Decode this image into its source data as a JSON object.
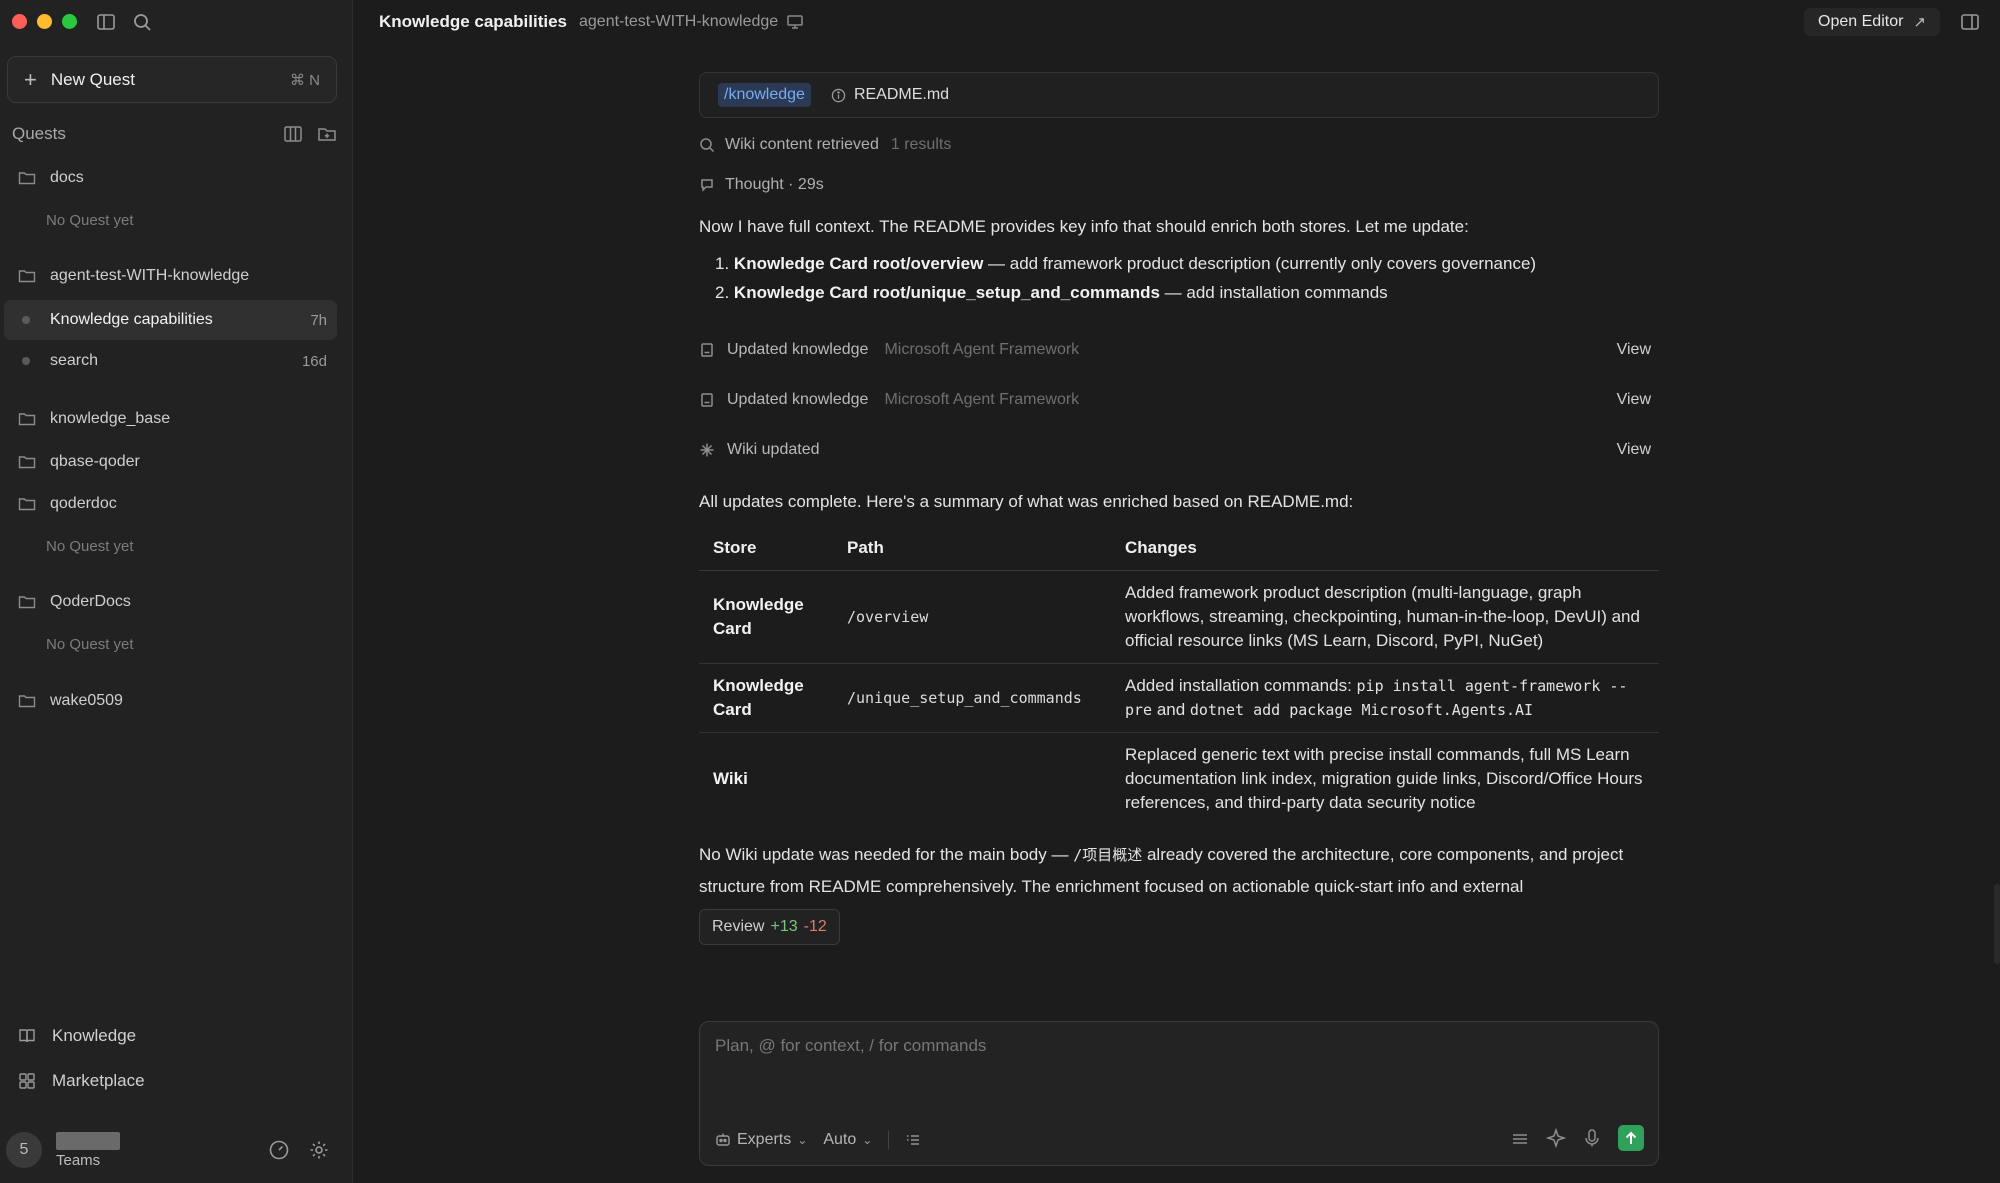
{
  "window": {
    "traffic_colors": [
      "#ff5f57",
      "#febc2e",
      "#28c840"
    ]
  },
  "sidebar": {
    "new_quest_label": "New Quest",
    "new_quest_shortcut": "⌘ N",
    "quests_title": "Quests",
    "groups": [
      {
        "name": "docs",
        "empty": "No Quest yet"
      },
      {
        "name": "agent-test-WITH-knowledge"
      },
      {
        "name": "knowledge_base"
      },
      {
        "name": "qbase-qoder"
      },
      {
        "name": "qoderdoc",
        "empty": "No Quest yet"
      },
      {
        "name": "QoderDocs",
        "empty": "No Quest yet"
      },
      {
        "name": "wake0509"
      }
    ],
    "quests": [
      {
        "name": "Knowledge capabilities",
        "age": "7h"
      },
      {
        "name": "search",
        "age": "16d"
      }
    ],
    "bottom": {
      "knowledge": "Knowledge",
      "marketplace": "Marketplace",
      "avatar_initial": "5",
      "team_label": "Teams"
    }
  },
  "topbar": {
    "title": "Knowledge capabilities",
    "subtitle": "agent-test-WITH-knowledge",
    "open_editor": "Open Editor"
  },
  "content": {
    "tag_path": "/knowledge",
    "tag_file": "README.md",
    "wiki_retrieved": "Wiki content retrieved",
    "wiki_results": "1 results",
    "thought": "Thought · 29s",
    "intro": "Now I have full context. The README provides key info that should enrich both stores. Let me update:",
    "list": [
      {
        "num": "1.",
        "bold": "Knowledge Card root/overview",
        "rest": " — add framework product description (currently only covers governance)"
      },
      {
        "num": "2.",
        "bold": "Knowledge Card root/unique_setup_and_commands",
        "rest": " — add installation commands"
      }
    ],
    "updates": [
      {
        "label": "Updated knowledge",
        "target": "Microsoft Agent Framework",
        "action": "View"
      },
      {
        "label": "Updated knowledge",
        "target": "Microsoft Agent Framework",
        "action": "View"
      },
      {
        "label": "Wiki updated",
        "target": "",
        "action": "View"
      }
    ],
    "summary_intro": "All updates complete. Here's a summary of what was enriched based on README.md:",
    "table": {
      "headers": [
        "Store",
        "Path",
        "Changes"
      ],
      "rows": [
        {
          "store": "Knowledge Card",
          "path": "/overview",
          "changes": "Added framework product description (multi-language, graph workflows, streaming, checkpointing, human-in-the-loop, DevUI) and official resource links (MS Learn, Discord, PyPI, NuGet)"
        },
        {
          "store": "Knowledge Card",
          "path": "/unique_setup_and_commands",
          "changes_a": "Added installation commands: ",
          "cmd1": "pip install agent-framework --pre",
          "changes_b": " and ",
          "cmd2": "dotnet add package Microsoft.Agents.AI"
        },
        {
          "store": "Wiki",
          "path": "",
          "changes": "Replaced generic text with precise install commands, full MS Learn documentation link index, migration guide links, Discord/Office Hours references, and third-party data security notice"
        }
      ]
    },
    "closing_a": "No Wiki update was needed for the main body — ",
    "closing_path": "/项目概述",
    "closing_b": " already covered the architecture, core components, and project structure from README comprehensively. The enrichment focused on actionable quick-start info and external",
    "review_label": "Review",
    "review_plus": "+13",
    "review_minus": "-12"
  },
  "composer": {
    "placeholder": "Plan, @ for context, / for commands",
    "experts": "Experts",
    "mode": "Auto",
    "send_color": "#2fa15a"
  }
}
